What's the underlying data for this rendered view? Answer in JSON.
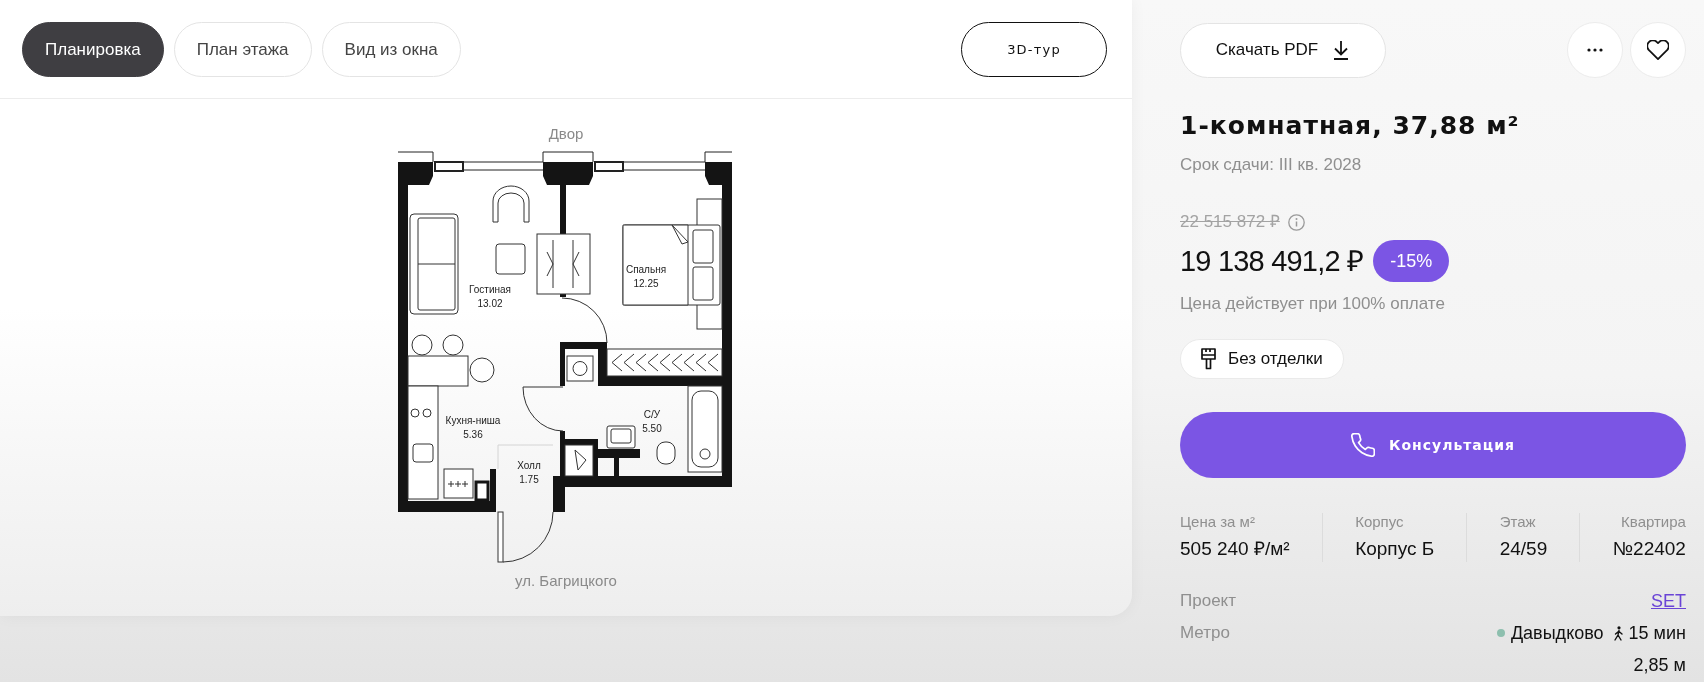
{
  "tabs": [
    {
      "label": "Планировка",
      "selected": true
    },
    {
      "label": "План этажа",
      "selected": false
    },
    {
      "label": "Вид из окна",
      "selected": false
    }
  ],
  "tour_button": "3D-тур",
  "plan": {
    "top_label": "Двор",
    "bottom_label": "ул. Багрицкого",
    "rooms": [
      {
        "name": "Гостиная",
        "area": "13.02"
      },
      {
        "name": "Спальня",
        "area": "12.25"
      },
      {
        "name": "Кухня-ниша",
        "area": "5.36"
      },
      {
        "name": "С/У",
        "area": "5.50"
      },
      {
        "name": "Холл",
        "area": "1.75"
      }
    ]
  },
  "pdf_button": "Скачать PDF",
  "listing": {
    "title": "1-комнатная, 37,88 м²",
    "completion": "Срок сдачи: III кв. 2028",
    "old_price": "22 515 872 ₽",
    "price": "19 138 491,2 ₽",
    "discount": "-15%",
    "price_note": "Цена действует при 100% оплате",
    "finish": "Без отделки",
    "cta": "Консультация"
  },
  "stats": [
    {
      "label": "Цена за м²",
      "value": "505 240 ₽/м²"
    },
    {
      "label": "Корпус",
      "value": "Корпус Б"
    },
    {
      "label": "Этаж",
      "value": "24/59"
    },
    {
      "label": "Квартира",
      "value": "№22402"
    }
  ],
  "details": [
    {
      "kind": "link",
      "label": "Проект",
      "value": "SET"
    },
    {
      "kind": "metro",
      "label": "Метро",
      "station": "Давыдково",
      "color": "#8dbfae",
      "walk_time": "15 мин"
    },
    {
      "kind": "plain",
      "value": "2,85 м"
    }
  ]
}
